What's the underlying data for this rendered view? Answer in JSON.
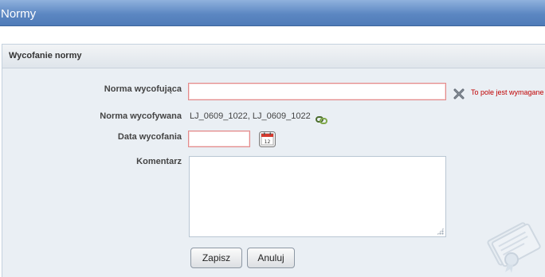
{
  "window": {
    "title": "Normy"
  },
  "panel": {
    "title": "Wycofanie normy"
  },
  "form": {
    "withdrawing_norm": {
      "label": "Norma wycofująca",
      "value": "",
      "error": "To pole jest wymagane"
    },
    "withdrawn_norm": {
      "label": "Norma wycofywana",
      "value": "LJ_0609_1022, LJ_0609_1022"
    },
    "withdrawal_date": {
      "label": "Data wycofania",
      "value": "",
      "calendar_day": "12"
    },
    "comment": {
      "label": "Komentarz",
      "value": ""
    }
  },
  "buttons": {
    "save": "Zapisz",
    "cancel": "Anuluj"
  },
  "icons": {
    "clear": "close-x-icon",
    "link": "link-chain-icon",
    "calendar": "calendar-icon",
    "watermark": "document-ribbon-icon"
  },
  "colors": {
    "titlebar": "#5c87c2",
    "panel_bg": "#eaeff4",
    "error": "#c00000",
    "invalid_border": "#e38b8b"
  }
}
